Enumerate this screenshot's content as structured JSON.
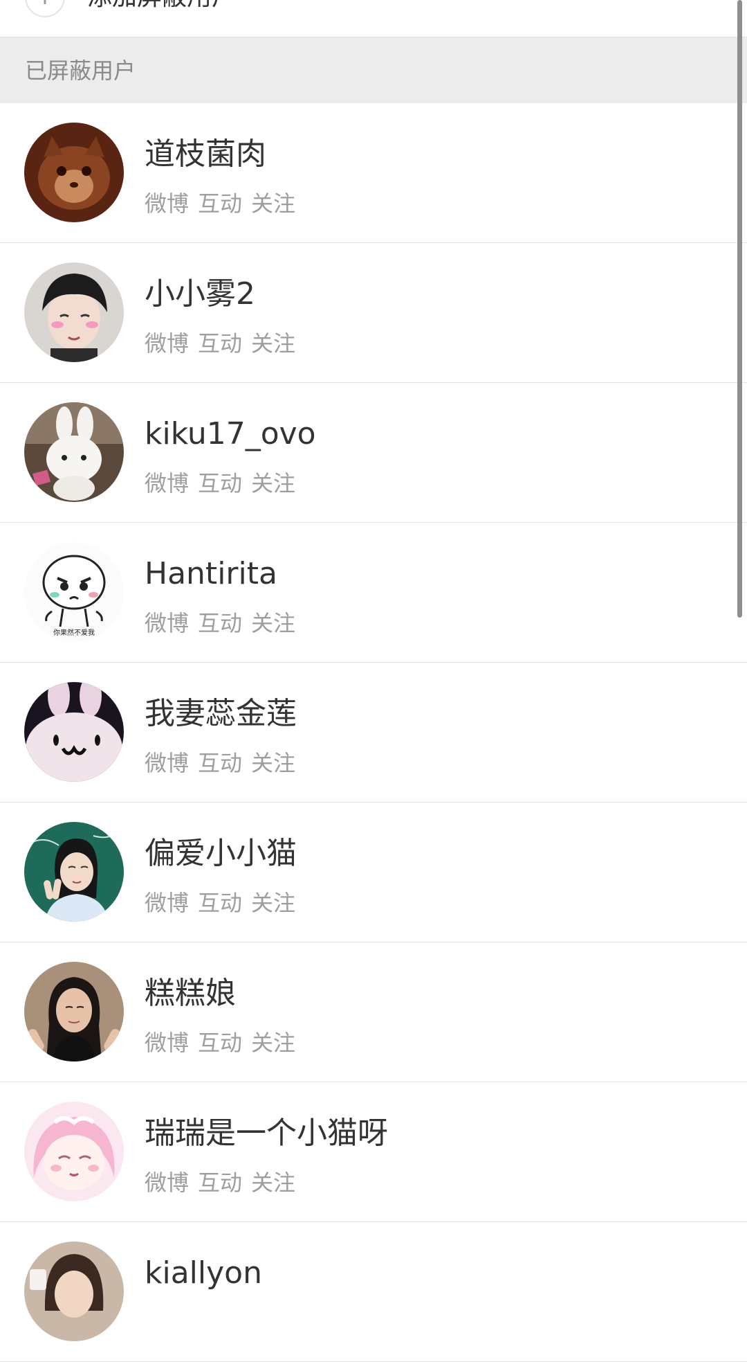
{
  "add_row": {
    "label": "添加屏蔽用户",
    "icon": "plus-icon"
  },
  "section": {
    "title": "已屏蔽用户"
  },
  "actions_labels": {
    "weibo": "微博",
    "interact": "互动",
    "follow": "关注"
  },
  "users": [
    {
      "name": "道枝菌肉",
      "avatar": "cat-avatar"
    },
    {
      "name": "小小雾2",
      "avatar": "boy-avatar"
    },
    {
      "name": "kiku17_ovo",
      "avatar": "plush-rabbit-avatar"
    },
    {
      "name": "Hantirita",
      "avatar": "cartoon-avatar",
      "avatar_caption": "你果然不爱我"
    },
    {
      "name": "我妻蕊金莲",
      "avatar": "bunny-avatar"
    },
    {
      "name": "偏爱小小猫",
      "avatar": "girl-chalkboard-avatar"
    },
    {
      "name": "糕糕娘",
      "avatar": "girl-avatar"
    },
    {
      "name": "瑞瑞是一个小猫呀",
      "avatar": "anime-girl-avatar"
    },
    {
      "name": "kiallyon",
      "avatar": "girl-avatar-2"
    }
  ]
}
